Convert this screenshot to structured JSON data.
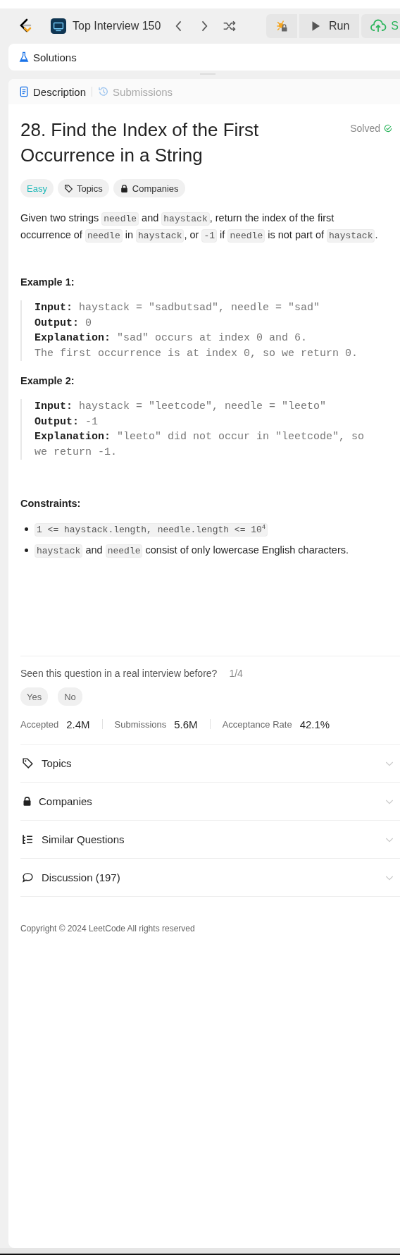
{
  "toolbar": {
    "problem_list": "Top Interview 150",
    "run": "Run",
    "submit": "S"
  },
  "solutions_tab": {
    "label": "Solutions"
  },
  "tabs": [
    {
      "label": "Description",
      "selected": true
    },
    {
      "label": "Submissions",
      "selected": false
    }
  ],
  "problem": {
    "title": "28. Find the Index of the First Occurrence in a String",
    "status": "Solved",
    "difficulty": "Easy",
    "tags": [
      {
        "label": "Topics",
        "kind": "tag"
      },
      {
        "label": "Companies",
        "kind": "lock"
      }
    ],
    "description": [
      {
        "text": "Given two strings ",
        "code": false
      },
      {
        "text": "needle",
        "code": true
      },
      {
        "text": " and ",
        "code": false
      },
      {
        "text": "haystack",
        "code": true
      },
      {
        "text": ", return the index of the first occurrence of ",
        "code": false
      },
      {
        "text": "needle",
        "code": true
      },
      {
        "text": " in ",
        "code": false
      },
      {
        "text": "haystack",
        "code": true
      },
      {
        "text": ", or ",
        "code": false
      },
      {
        "text": "-1",
        "code": true
      },
      {
        "text": " if ",
        "code": false
      },
      {
        "text": "needle",
        "code": true
      },
      {
        "text": " is not part of ",
        "code": false
      },
      {
        "text": "haystack",
        "code": true
      },
      {
        "text": ".",
        "code": false
      }
    ],
    "examples": [
      {
        "heading": "Example 1:",
        "lines": [
          "**Input:** haystack = \"sadbutsad\", needle = \"sad\"",
          "**Output:** 0",
          "**Explanation:** \"sad\" occurs at index 0 and 6.",
          "The first occurrence is at index 0, so we return 0."
        ]
      },
      {
        "heading": "Example 2:",
        "lines": [
          "**Input:** haystack = \"leetcode\", needle = \"leeto\"",
          "**Output:** -1",
          "**Explanation:** \"leeto\" did not occur in \"leetcode\", so we return -1."
        ]
      }
    ],
    "constraints_heading": "Constraints:",
    "constraints": [
      [
        {
          "text": "1 <= haystack.length, needle.length <= 10$^{4}$",
          "code": true
        }
      ],
      [
        {
          "text": "haystack",
          "code": true
        },
        {
          "text": " and ",
          "code": false
        },
        {
          "text": "needle",
          "code": true
        },
        {
          "text": " consist of only lowercase English characters.",
          "code": false
        }
      ]
    ]
  },
  "interview": {
    "question": "Seen this question in a real interview before?",
    "count": "1/4",
    "answers": [
      "Yes",
      "No"
    ]
  },
  "stats": [
    {
      "label": "Accepted",
      "value": "2.4M"
    },
    {
      "label": "Submissions",
      "value": "5.6M"
    },
    {
      "label": "Acceptance Rate",
      "value": "42.1%"
    }
  ],
  "sections": [
    {
      "label": "Topics",
      "kind": "tag"
    },
    {
      "label": "Companies",
      "kind": "lock"
    },
    {
      "label": "Similar Questions",
      "kind": "list"
    },
    {
      "label": "Discussion (197)",
      "kind": "chat"
    }
  ],
  "copyright": "Copyright © 2024 LeetCode All rights reserved"
}
